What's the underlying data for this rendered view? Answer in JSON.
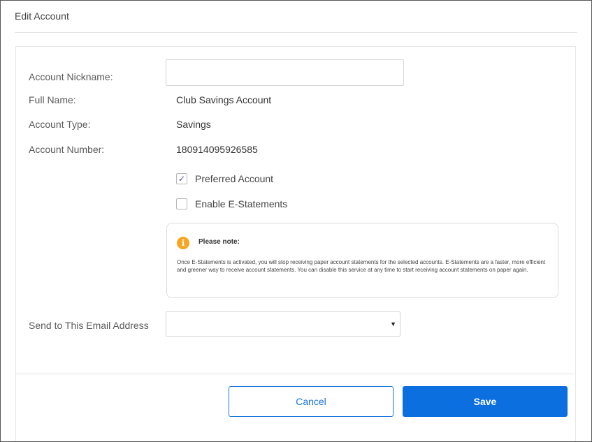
{
  "dialog": {
    "title": "Edit Account"
  },
  "form": {
    "nickname": {
      "label": "Account Nickname:",
      "value": ""
    },
    "full_name": {
      "label": "Full Name:",
      "value": "Club Savings Account"
    },
    "account_type": {
      "label": "Account Type:",
      "value": "Savings"
    },
    "account_number": {
      "label": "Account Number:",
      "value": "180914095926585"
    },
    "preferred": {
      "label": "Preferred Account",
      "checked": true
    },
    "estatements": {
      "label": "Enable E-Statements",
      "checked": false
    },
    "note": {
      "icon": "info-icon",
      "title": "Please note:",
      "body": "Once E-Statements is activated, you will stop receiving paper account statements for the selected accounts. E-Statements are a faster, more efficient and greener way to receive account statements. You can disable this service at any time to start receiving account statements on paper again."
    },
    "email": {
      "label": "Send to This Email Address",
      "value": ""
    }
  },
  "buttons": {
    "cancel": "Cancel",
    "save": "Save"
  },
  "colors": {
    "primary": "#0b6fe0",
    "warning": "#f5a623",
    "check": "#4a4aa8"
  }
}
